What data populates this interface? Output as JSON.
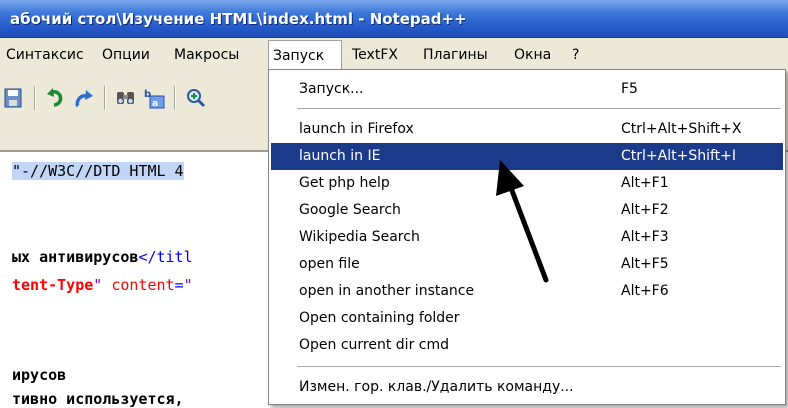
{
  "window": {
    "title": "абочий стол\\Изучение HTML\\index.html - Notepad++"
  },
  "menubar": {
    "items": [
      {
        "label": "Синтаксис"
      },
      {
        "label": "Опции"
      },
      {
        "label": "Макросы"
      },
      {
        "label": "Запуск"
      },
      {
        "label": "TextFX"
      },
      {
        "label": "Плагины"
      },
      {
        "label": "Окна"
      },
      {
        "label": "?"
      }
    ]
  },
  "toolbar": {
    "icons": [
      "save-icon",
      "undo-icon",
      "redo-icon",
      "find-icon",
      "replace-icon",
      "zoom-in-icon"
    ]
  },
  "editor": {
    "line1": {
      "text": "\"-//W3C//DTD HTML 4"
    },
    "line2": {
      "bold": "ых антивирусов",
      "tag": "</titl"
    },
    "line3": {
      "attr": "tent-Type",
      "q1": "\" ",
      "name": "content",
      "eq": "=",
      "q2": "\""
    },
    "line4": {
      "text": "ирусов"
    },
    "line5": {
      "text": "тивно используется,"
    }
  },
  "dropdown": {
    "items": [
      {
        "label": "Запуск...",
        "shortcut": "F5"
      },
      {
        "label": "launch in Firefox",
        "shortcut": "Ctrl+Alt+Shift+X"
      },
      {
        "label": "launch in IE",
        "shortcut": "Ctrl+Alt+Shift+I"
      },
      {
        "label": "Get php help",
        "shortcut": "Alt+F1"
      },
      {
        "label": "Google Search",
        "shortcut": "Alt+F2"
      },
      {
        "label": "Wikipedia Search",
        "shortcut": "Alt+F3"
      },
      {
        "label": "open file",
        "shortcut": "Alt+F5"
      },
      {
        "label": "open in another instance",
        "shortcut": "Alt+F6"
      },
      {
        "label": "Open containing folder",
        "shortcut": ""
      },
      {
        "label": "Open current dir cmd",
        "shortcut": ""
      },
      {
        "label": "Измен. гор. клав./Удалить команду...",
        "shortcut": ""
      }
    ]
  },
  "colors": {
    "highlight": "#1b3a8a",
    "title_bar": "#2458c6",
    "menu_bg": "#ece9d8"
  }
}
